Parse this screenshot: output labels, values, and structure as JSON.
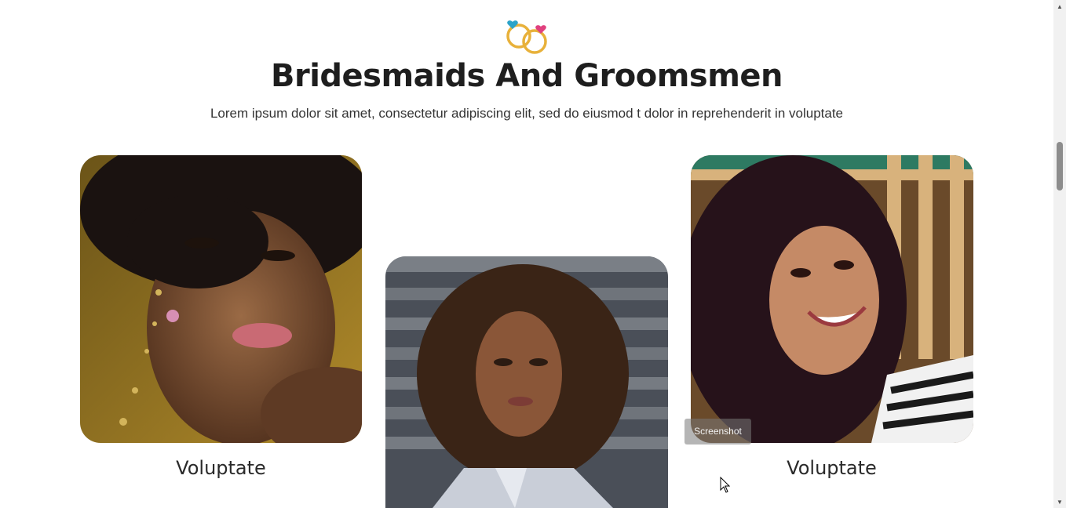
{
  "section": {
    "title": "Bridesmaids And Groomsmen",
    "subtitle": "Lorem ipsum dolor sit amet, consectetur adipiscing elit, sed do eiusmod t dolor in reprehenderit in voluptate"
  },
  "cards": [
    {
      "name": "Voluptate",
      "photo": "portrait-woman-glitter-face"
    },
    {
      "name": "",
      "photo": "portrait-woman-curly-hair-striped-shirt"
    },
    {
      "name": "Voluptate",
      "photo": "portrait-woman-smiling-curly-hair"
    }
  ],
  "overlay": {
    "screenshot_label": "Screenshot"
  },
  "icons": {
    "rings": "wedding-rings-icon",
    "cursor": "mouse-cursor-icon",
    "scroll_up": "scroll-up-arrow-icon",
    "scroll_down": "scroll-down-arrow-icon"
  },
  "colors": {
    "ring_gold": "#e8b13a",
    "heart_blue": "#2ba3c9",
    "heart_pink": "#e0407e",
    "title": "#1e1e1e"
  },
  "scroll": {
    "position": 0.3
  }
}
